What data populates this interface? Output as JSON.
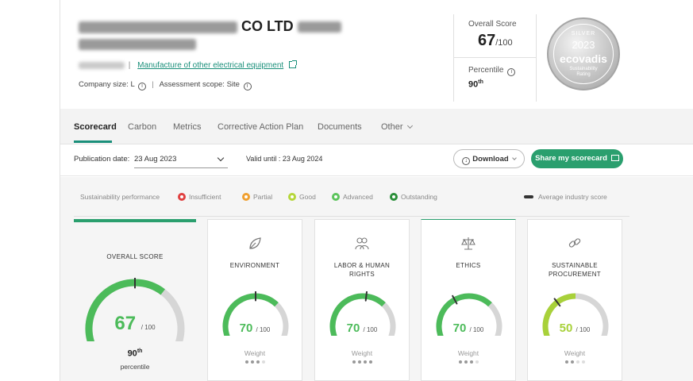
{
  "company": {
    "name_suffix": "CO LTD",
    "industry_link": "Manufacture of other electrical equipment",
    "company_size_label": "Company size: L",
    "assessment_scope_label": "Assessment scope: Site"
  },
  "summary": {
    "overall_score_label": "Overall Score",
    "overall_score_value": "67",
    "overall_score_max": "/100",
    "percentile_label": "Percentile",
    "percentile_value": "90",
    "percentile_suffix": "th"
  },
  "medal": {
    "level": "SILVER",
    "year": "2023",
    "brand": "ecovadis",
    "line1": "Sustainability",
    "line2": "Rating"
  },
  "tabs": [
    {
      "label": "Scorecard",
      "active": true
    },
    {
      "label": "Carbon"
    },
    {
      "label": "Metrics"
    },
    {
      "label": "Corrective Action Plan"
    },
    {
      "label": "Documents"
    },
    {
      "label": "Other"
    }
  ],
  "toolbar": {
    "publication_label": "Publication date:",
    "publication_value": "23 Aug 2023",
    "valid_until": "Valid until : 23 Aug 2024",
    "download_label": "Download",
    "share_label": "Share my scorecard"
  },
  "legend": {
    "title": "Sustainability performance",
    "items": [
      {
        "label": "Insufficient",
        "color": "#e04040"
      },
      {
        "label": "Partial",
        "color": "#f0a030"
      },
      {
        "label": "Good",
        "color": "#b5d63a"
      },
      {
        "label": "Advanced",
        "color": "#5cc45c"
      },
      {
        "label": "Outstanding",
        "color": "#2b8f3a"
      }
    ],
    "average_label": "Average industry score"
  },
  "overall_card": {
    "title": "OVERALL SCORE",
    "score": "67",
    "max": "/ 100",
    "score_fraction": 0.67,
    "percentile_value": "90",
    "percentile_suffix": "th",
    "percentile_label": "percentile",
    "color": "#4cbb5a"
  },
  "themes": [
    {
      "title": [
        "ENVIRONMENT"
      ],
      "score": "70",
      "max": "/ 100",
      "score_fraction": 0.7,
      "avg_fraction": 0.5,
      "weight_label": "Weight",
      "weight_level": 3,
      "color": "#4cbb5a",
      "icon": "leaf-icon"
    },
    {
      "title": [
        "LABOR & HUMAN",
        "RIGHTS"
      ],
      "score": "70",
      "max": "/ 100",
      "score_fraction": 0.7,
      "avg_fraction": 0.53,
      "weight_label": "Weight",
      "weight_level": 4,
      "color": "#4cbb5a",
      "icon": "people-icon"
    },
    {
      "title": [
        "ETHICS"
      ],
      "score": "70",
      "max": "/ 100",
      "score_fraction": 0.7,
      "avg_fraction": 0.37,
      "weight_label": "Weight",
      "weight_level": 3,
      "color": "#4cbb5a",
      "icon": "scales-icon"
    },
    {
      "title": [
        "SUSTAINABLE",
        "PROCUREMENT"
      ],
      "score": "50",
      "max": "/ 100",
      "score_fraction": 0.5,
      "avg_fraction": 0.33,
      "weight_label": "Weight",
      "weight_level": 2,
      "color": "#a8d13a",
      "icon": "link-icon"
    }
  ]
}
